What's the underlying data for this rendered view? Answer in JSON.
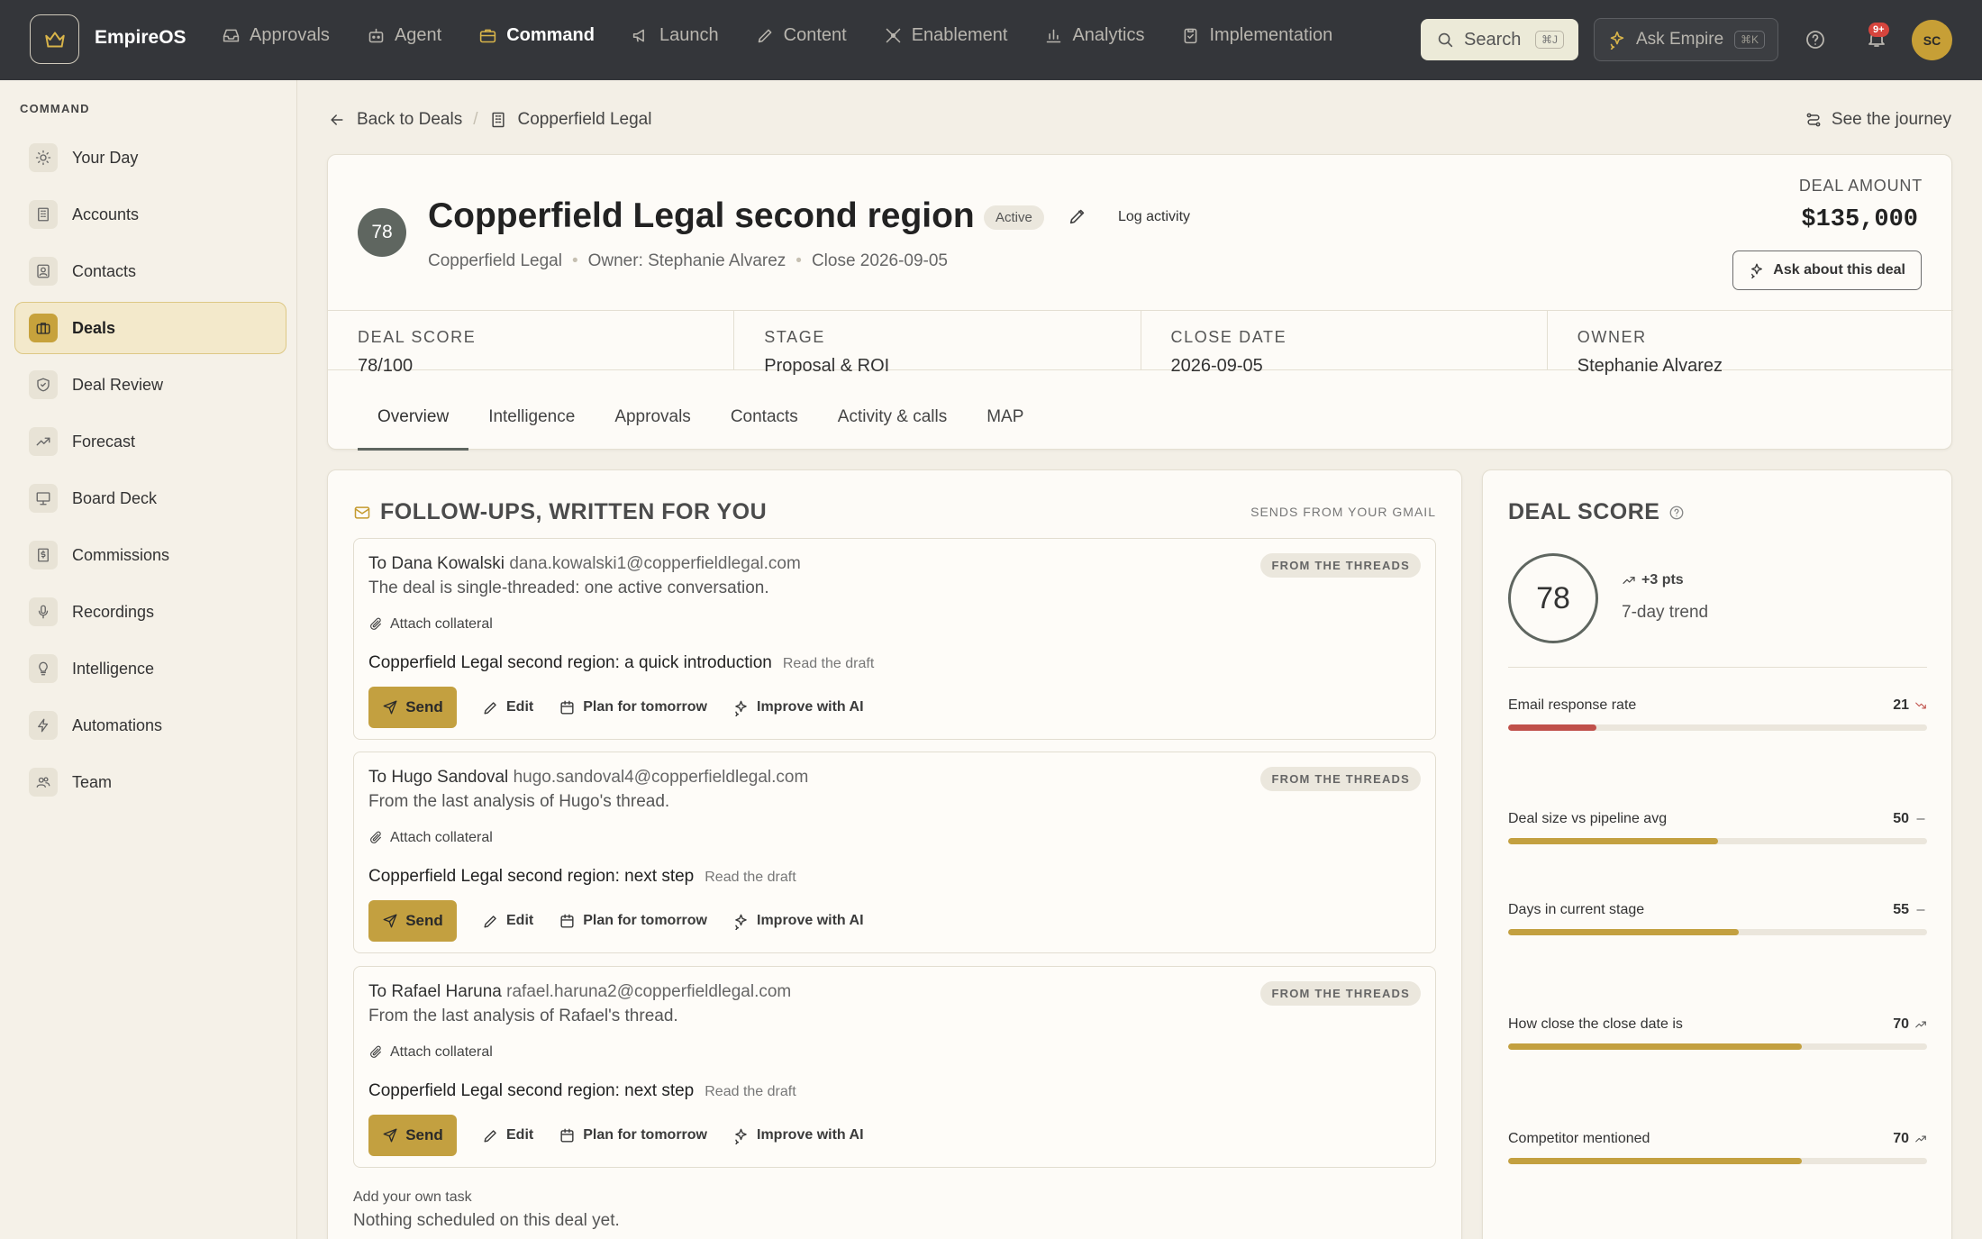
{
  "app": {
    "name": "EmpireOS",
    "avatar_initials": "SC",
    "notifications_badge": "9+"
  },
  "topnav": [
    {
      "label": "Approvals",
      "icon": "inbox-icon",
      "active": false
    },
    {
      "label": "Agent",
      "icon": "bot-icon",
      "active": false
    },
    {
      "label": "Command",
      "icon": "briefcase-icon",
      "active": true
    },
    {
      "label": "Launch",
      "icon": "megaphone-icon",
      "active": false
    },
    {
      "label": "Content",
      "icon": "pencil-icon",
      "active": false
    },
    {
      "label": "Enablement",
      "icon": "tools-icon",
      "active": false
    },
    {
      "label": "Analytics",
      "icon": "bar-chart-icon",
      "active": false
    },
    {
      "label": "Implementation",
      "icon": "clipboard-icon",
      "active": false
    }
  ],
  "search": {
    "label": "Search",
    "shortcut": "⌘J"
  },
  "ask_empire": {
    "label": "Ask Empire",
    "shortcut": "⌘K"
  },
  "sidebar": {
    "heading": "COMMAND",
    "items": [
      {
        "label": "Your Day",
        "icon": "sun-icon",
        "active": false
      },
      {
        "label": "Accounts",
        "icon": "building-icon",
        "active": false
      },
      {
        "label": "Contacts",
        "icon": "contact-card-icon",
        "active": false
      },
      {
        "label": "Deals",
        "icon": "briefcase-icon",
        "active": true
      },
      {
        "label": "Deal Review",
        "icon": "shield-icon",
        "active": false
      },
      {
        "label": "Forecast",
        "icon": "trending-up-icon",
        "active": false
      },
      {
        "label": "Board Deck",
        "icon": "presentation-icon",
        "active": false
      },
      {
        "label": "Commissions",
        "icon": "dollar-doc-icon",
        "active": false
      },
      {
        "label": "Recordings",
        "icon": "microphone-icon",
        "active": false
      },
      {
        "label": "Intelligence",
        "icon": "lightbulb-icon",
        "active": false
      },
      {
        "label": "Automations",
        "icon": "lightning-icon",
        "active": false
      },
      {
        "label": "Team",
        "icon": "users-icon",
        "active": false
      }
    ]
  },
  "breadcrumb": {
    "back": "Back to Deals",
    "current": "Copperfield Legal"
  },
  "journey_link": "See the journey",
  "deal": {
    "score": "78",
    "title": "Copperfield Legal second region",
    "status": "Active",
    "log_activity": "Log activity",
    "account": "Copperfield Legal",
    "owner_text": "Owner: Stephanie Alvarez",
    "close_text": "Close 2026-09-05",
    "amount_label": "DEAL AMOUNT",
    "amount": "$135,000",
    "ask_button": "Ask about this deal"
  },
  "stats": [
    {
      "label": "DEAL SCORE",
      "value": "78/100"
    },
    {
      "label": "STAGE",
      "value": "Proposal & ROI"
    },
    {
      "label": "CLOSE DATE",
      "value": "2026-09-05"
    },
    {
      "label": "OWNER",
      "value": "Stephanie Alvarez"
    }
  ],
  "tabs": [
    {
      "label": "Overview",
      "active": true
    },
    {
      "label": "Intelligence",
      "active": false
    },
    {
      "label": "Approvals",
      "active": false
    },
    {
      "label": "Contacts",
      "active": false
    },
    {
      "label": "Activity & calls",
      "active": false
    },
    {
      "label": "MAP",
      "active": false
    }
  ],
  "followups": {
    "title": "FOLLOW-UPS, WRITTEN FOR YOU",
    "subtitle": "SENDS FROM YOUR GMAIL",
    "items": [
      {
        "to_prefix": "To Dana Kowalski",
        "email": "dana.kowalski1@copperfieldlegal.com",
        "desc": "The deal is single-threaded: one active conversation.",
        "badge": "FROM THE THREADS",
        "attach": "Attach collateral",
        "subject": "Copperfield Legal second region: a quick introduction",
        "read_draft": "Read the draft",
        "send": "Send",
        "edit": "Edit",
        "plan": "Plan for tomorrow",
        "improve": "Improve with AI"
      },
      {
        "to_prefix": "To Hugo Sandoval",
        "email": "hugo.sandoval4@copperfieldlegal.com",
        "desc": "From the last analysis of Hugo's thread.",
        "badge": "FROM THE THREADS",
        "attach": "Attach collateral",
        "subject": "Copperfield Legal second region: next step",
        "read_draft": "Read the draft",
        "send": "Send",
        "edit": "Edit",
        "plan": "Plan for tomorrow",
        "improve": "Improve with AI"
      },
      {
        "to_prefix": "To Rafael Haruna",
        "email": "rafael.haruna2@copperfieldlegal.com",
        "desc": "From the last analysis of Rafael's thread.",
        "badge": "FROM THE THREADS",
        "attach": "Attach collateral",
        "subject": "Copperfield Legal second region: next step",
        "read_draft": "Read the draft",
        "send": "Send",
        "edit": "Edit",
        "plan": "Plan for tomorrow",
        "improve": "Improve with AI"
      }
    ],
    "own_task_label": "Add your own task",
    "own_task_empty": "Nothing scheduled on this deal yet."
  },
  "score_panel": {
    "title": "DEAL SCORE",
    "score": "78",
    "trend_pts": "+3 pts",
    "trend_label": "7-day trend",
    "factors": [
      {
        "label": "Email response rate",
        "value": 21,
        "value_text": "21",
        "trend": "down",
        "color": "#c0504a"
      },
      {
        "label": "Deal size vs pipeline avg",
        "value": 50,
        "value_text": "50",
        "trend": "flat",
        "color": "#c3a040"
      },
      {
        "label": "Days in current stage",
        "value": 55,
        "value_text": "55",
        "trend": "flat",
        "color": "#c3a040"
      },
      {
        "label": "How close the close date is",
        "value": 70,
        "value_text": "70",
        "trend": "up",
        "color": "#c3a040"
      },
      {
        "label": "Competitor mentioned",
        "value": 70,
        "value_text": "70",
        "trend": "up",
        "color": "#c3a040"
      }
    ]
  },
  "colors": {
    "accent": "#c3a040",
    "topbar": "#34363a",
    "danger": "#c0504a"
  }
}
